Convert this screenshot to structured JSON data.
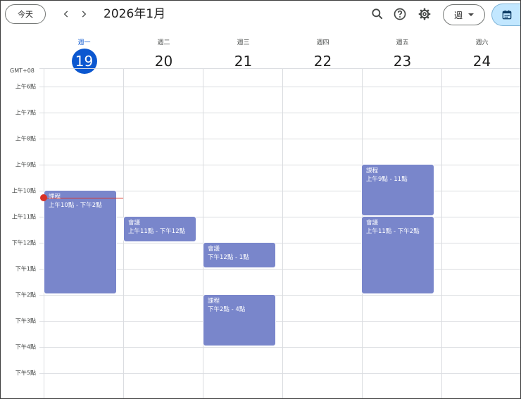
{
  "toolbar": {
    "today_label": "今天",
    "prev_icon": "chevron-left-icon",
    "next_icon": "chevron-right-icon",
    "month_title": "2026年1月",
    "search_icon": "search-icon",
    "help_icon": "help-icon",
    "settings_icon": "gear-icon",
    "view_label": "週",
    "calendar_icon": "calendar-icon"
  },
  "week": {
    "timezone": "GMT+08",
    "days": [
      {
        "name": "週一",
        "num": "19",
        "today": true
      },
      {
        "name": "週二",
        "num": "20"
      },
      {
        "name": "週三",
        "num": "21"
      },
      {
        "name": "週四",
        "num": "22"
      },
      {
        "name": "週五",
        "num": "23"
      },
      {
        "name": "週六",
        "num": "24"
      }
    ],
    "hours": [
      "上午6點",
      "上午7點",
      "上午8點",
      "上午9點",
      "上午10點",
      "上午11點",
      "下午12點",
      "下午1點",
      "下午2點",
      "下午3點",
      "下午4點",
      "下午5點"
    ]
  },
  "events": [
    {
      "title": "課程",
      "time": "上午10點 - 下午2點",
      "day": "週一"
    },
    {
      "title": "會議",
      "time": "上午11點 - 下午12點",
      "day": "週二"
    },
    {
      "title": "會議",
      "time": "下午12點 - 1點",
      "day": "週三"
    },
    {
      "title": "課程",
      "time": "下午2點 - 4點",
      "day": "週三"
    },
    {
      "title": "課程",
      "time": "上午9點 - 11點",
      "day": "週五"
    },
    {
      "title": "會議",
      "time": "上午11點 - 下午2點",
      "day": "週五"
    }
  ],
  "colors": {
    "accent": "#0b57d0",
    "event": "#7986cb",
    "now_indicator": "#d93025"
  }
}
